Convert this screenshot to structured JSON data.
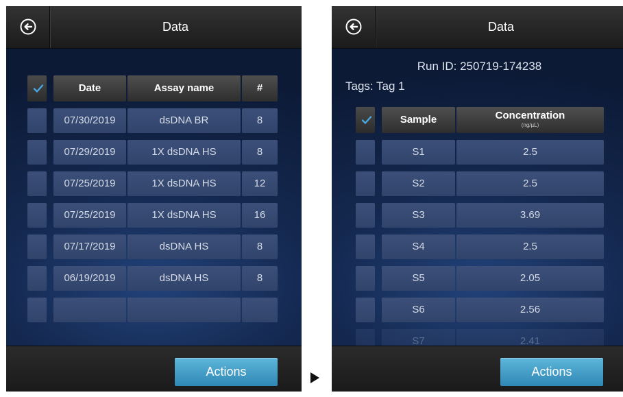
{
  "left": {
    "title": "Data",
    "columns": [
      "Date",
      "Assay name",
      "#"
    ],
    "rows": [
      {
        "date": "07/30/2019",
        "assay": "dsDNA BR",
        "count": "8"
      },
      {
        "date": "07/29/2019",
        "assay": "1X dsDNA HS",
        "count": "8"
      },
      {
        "date": "07/25/2019",
        "assay": "1X dsDNA HS",
        "count": "12"
      },
      {
        "date": "07/25/2019",
        "assay": "1X dsDNA HS",
        "count": "16"
      },
      {
        "date": "07/17/2019",
        "assay": "dsDNA HS",
        "count": "8"
      },
      {
        "date": "06/19/2019",
        "assay": "dsDNA HS",
        "count": "8"
      },
      {
        "date": "",
        "assay": "",
        "count": ""
      }
    ],
    "actions_label": "Actions"
  },
  "right": {
    "title": "Data",
    "run_id": "Run ID: 250719-174238",
    "tags": "Tags: Tag 1",
    "columns": {
      "sample": "Sample",
      "concentration": "Concentration",
      "unit": "(ng/µL)"
    },
    "rows": [
      {
        "sample": "S1",
        "conc": "2.5"
      },
      {
        "sample": "S2",
        "conc": "2.5"
      },
      {
        "sample": "S3",
        "conc": "3.69"
      },
      {
        "sample": "S4",
        "conc": "2.5"
      },
      {
        "sample": "S5",
        "conc": "2.05"
      },
      {
        "sample": "S6",
        "conc": "2.56"
      },
      {
        "sample": "S7",
        "conc": "2.41"
      }
    ],
    "actions_label": "Actions"
  },
  "icons": {
    "back": "back-arrow-icon",
    "check": "checkmark-icon",
    "next": "play-arrow-icon"
  },
  "colors": {
    "accent_button": "#3a9ac8",
    "checkmark": "#4aa6e0",
    "header_cell": "#3c3c3c",
    "data_cell": "#354a72"
  }
}
